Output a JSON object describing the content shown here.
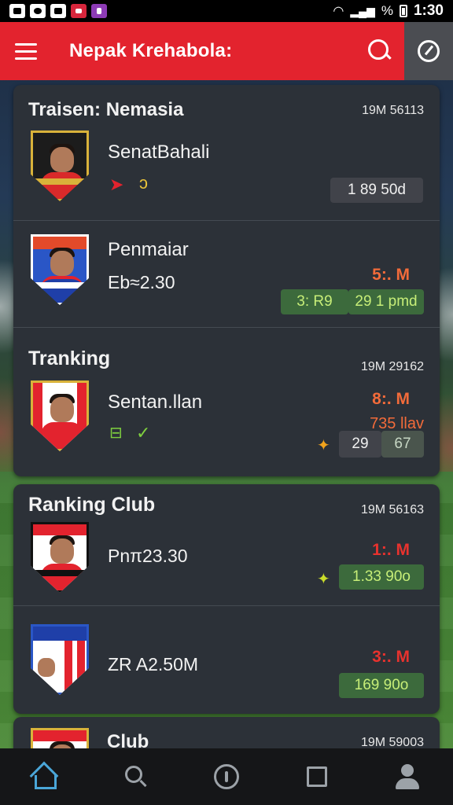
{
  "status_bar": {
    "signal_text": "%",
    "time": "1:30"
  },
  "app_bar": {
    "title": "Nepak Krehabola:"
  },
  "section_1": {
    "title": "Traisen: Nemasia",
    "meta": "19M 56113",
    "item": {
      "name": "SenatBahali",
      "badge": "1 89 50d"
    }
  },
  "section_2": {
    "item": {
      "name": "Penmaiar",
      "number": "Eb≈2.30",
      "stat": "5:. M",
      "badge_left": "3: R9",
      "badge_right": "29 1 pmd"
    }
  },
  "section_3": {
    "title": "Tranking",
    "meta": "19M 29162",
    "item": {
      "name": "Sentan.llan",
      "stat": "8:. M",
      "stat_2": "735 llav",
      "badge_left": "29",
      "badge_right": "67"
    }
  },
  "section_4": {
    "title": "Ranking Club",
    "meta": "19M 56163",
    "item": {
      "number": "Pnπ23.30",
      "stat": "1:. M",
      "badge": "1.33 90o"
    }
  },
  "section_5": {
    "item": {
      "number": "ZR A2.50M",
      "stat": "3:. M",
      "badge": "169 90o"
    }
  },
  "section_6": {
    "title": "Club",
    "meta": "19M 59003"
  },
  "colors": {
    "accent_red": "#e3232e",
    "card_bg": "#2c3138",
    "stat_orange": "#f26b3a",
    "badge_green": "#3c6a3c",
    "nav_active": "#4aa6d8"
  }
}
